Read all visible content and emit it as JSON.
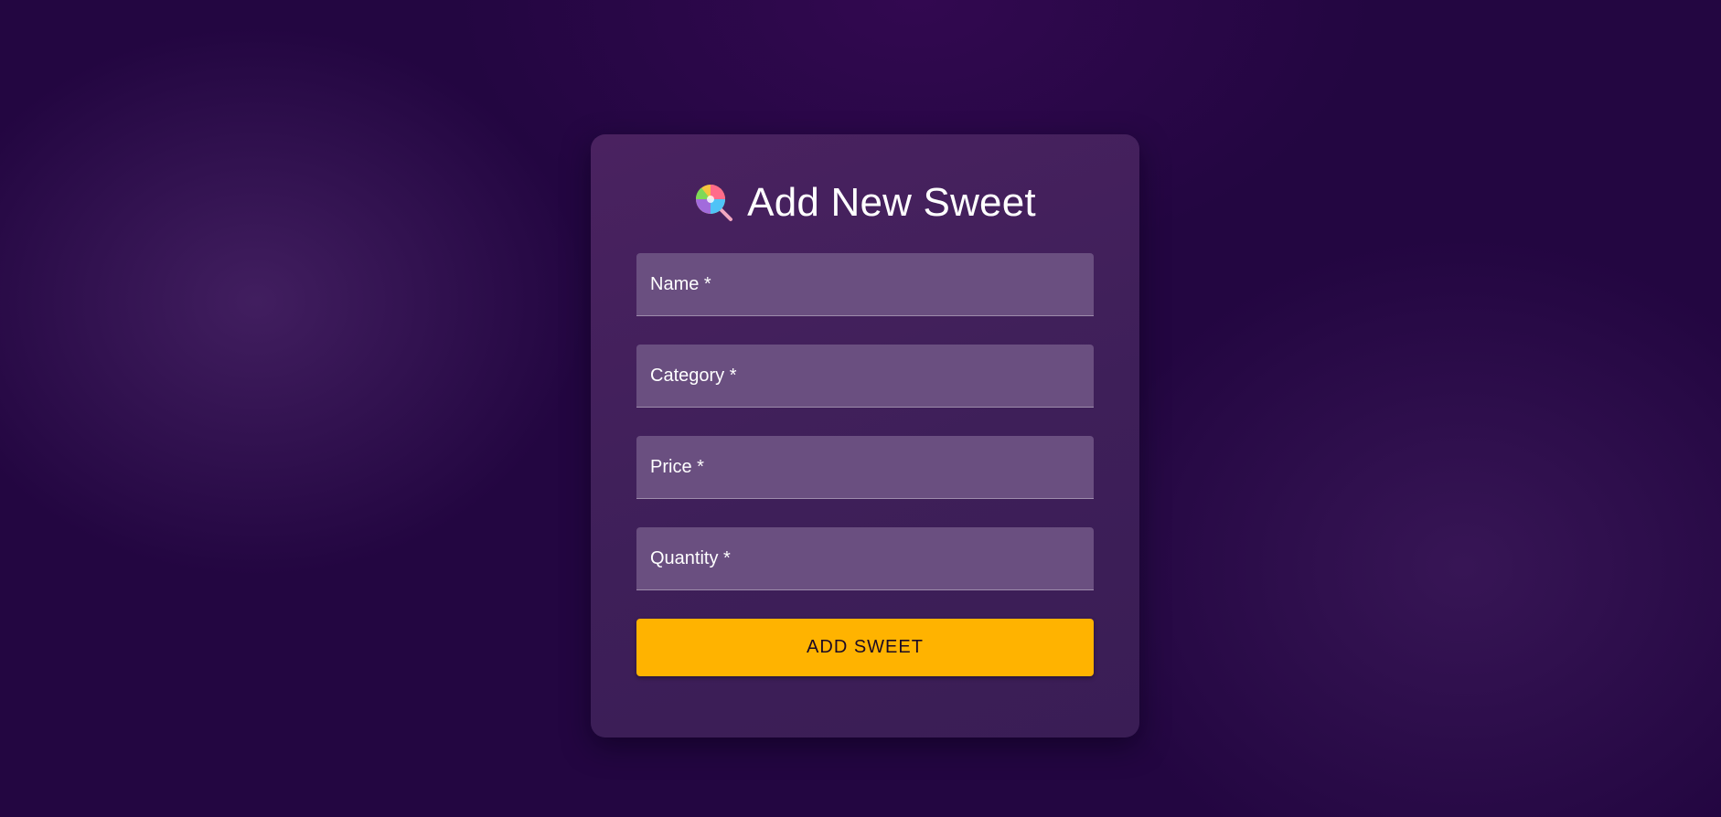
{
  "form": {
    "title": "Add New Sweet",
    "title_icon": "lollipop-icon",
    "fields": [
      {
        "name": "name",
        "placeholder": "Name *",
        "value": ""
      },
      {
        "name": "category",
        "placeholder": "Category *",
        "value": ""
      },
      {
        "name": "price",
        "placeholder": "Price *",
        "value": ""
      },
      {
        "name": "quantity",
        "placeholder": "Quantity *",
        "value": ""
      }
    ],
    "submit_label": "ADD SWEET"
  },
  "colors": {
    "background": "#230641",
    "card": "#3e1f59",
    "field": "#6a4f80",
    "accent": "#ffb300"
  }
}
